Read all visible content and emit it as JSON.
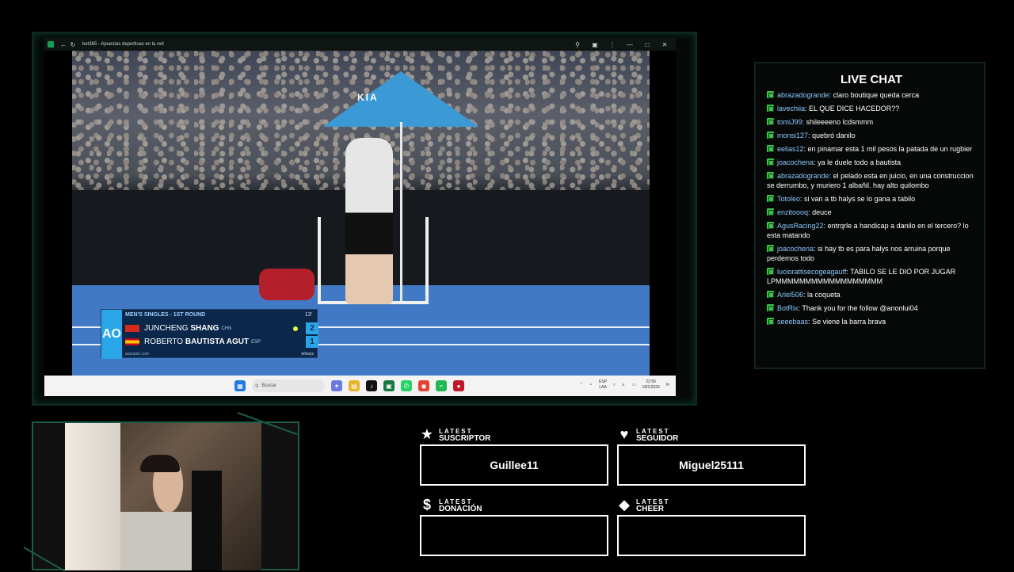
{
  "browser": {
    "title": "bet365 - Apuestas deportivas en la red"
  },
  "scoreboard": {
    "header": "MEN'S SINGLES - 1ST ROUND",
    "round_num": "13'",
    "ao_logo": "AO",
    "players": [
      {
        "first": "JUNCHENG",
        "last": "SHANG",
        "country": "CHN",
        "score": "2"
      },
      {
        "first": "ROBERTO",
        "last": "BAUTISTA AGUT",
        "country": "ESP",
        "score": "1"
      }
    ],
    "footer_left": "ausopen.com",
    "footer_right": "infosys"
  },
  "taskbar": {
    "search_placeholder": "Buscar",
    "lang_top": "ESP",
    "lang_bottom": "LAA",
    "time": "22:56",
    "date": "18/1/2026"
  },
  "chat": {
    "title": "LIVE CHAT",
    "messages": [
      {
        "user": "abrazadogrande",
        "text": "claro boutique queda cerca"
      },
      {
        "user": "lavechiia",
        "text": "EL QUE DICE HACEDOR??"
      },
      {
        "user": "tomiJ99",
        "text": "shileeeeno lcdsmmm"
      },
      {
        "user": "monsi127",
        "text": "quebró danilo"
      },
      {
        "user": "eelias12",
        "text": "en pinamar esta 1 mil pesos la patada de un rugbier"
      },
      {
        "user": "joacochena",
        "text": "ya le duele todo a bautista"
      },
      {
        "user": "abrazadogrande",
        "text": "el pelado esta en juicio, en una construccion se derrumbo, y muriero 1 albañil. hay alto quilombo"
      },
      {
        "user": "Totoleo",
        "text": "si van a tb halys se lo gana a tabilo"
      },
      {
        "user": "enzitoooq",
        "text": "deuce"
      },
      {
        "user": "AgusRacing22",
        "text": "entrqrle a handicap a danilo en el tercero? lo esta matando"
      },
      {
        "user": "joacochena",
        "text": "si hay tb es para halys nos arruina porque perdemos todo"
      },
      {
        "user": "luciorattisecogeagauff",
        "text": "TABILO SE LE DIO POR JUGAR LPMMMMMMMMMMMMMMMMMM"
      },
      {
        "user": "Ariel506",
        "text": "la coqueta"
      },
      {
        "user": "BotRix",
        "text": "Thank you for the follow @anonlui04"
      },
      {
        "user": "seeebaas",
        "text": "Se viene la barra brava"
      }
    ]
  },
  "alerts": {
    "suscriptor": {
      "small": "LATEST",
      "big": "SUSCRIPTOR",
      "value": "Guillee11"
    },
    "seguidor": {
      "small": "LATEST",
      "big": "SEGUIDOR",
      "value": "Miguel25111"
    },
    "donacion": {
      "small": "LATEST",
      "big": "DONACIÓN",
      "value": ""
    },
    "cheer": {
      "small": "LATEST",
      "big": "CHEER",
      "value": ""
    }
  }
}
